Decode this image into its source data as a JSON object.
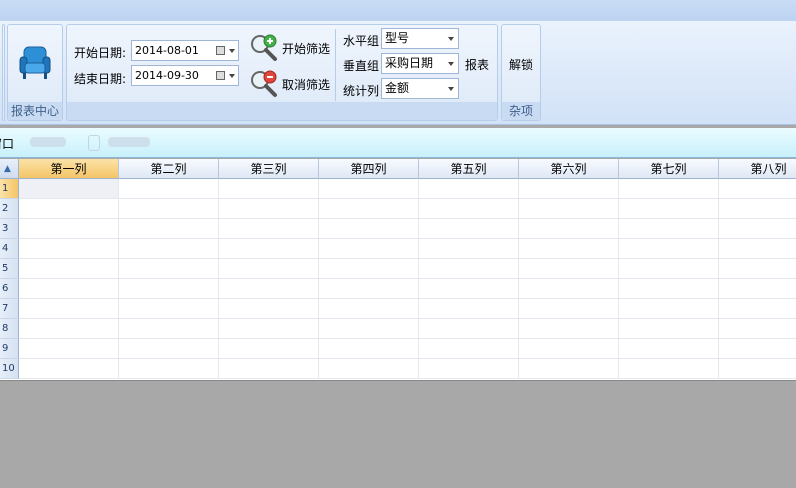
{
  "ribbon": {
    "report_center": {
      "label": "报表中心",
      "icon": "armchair-icon"
    },
    "filter": {
      "start_label": "开始日期:",
      "start_value": "2014-08-01",
      "end_label": "结束日期:",
      "end_value": "2014-09-30",
      "start_filter_label": "开始筛选",
      "cancel_filter_label": "取消筛选",
      "horizontal_label": "水平组",
      "horizontal_value": "型号",
      "vertical_label": "垂直组",
      "vertical_value": "采购日期",
      "stat_label": "统计列",
      "stat_value": "金额",
      "report_label": "报表"
    },
    "misc": {
      "unlock_label": "解锁",
      "group_label": "杂项"
    }
  },
  "tabs": {
    "window_label": "窗口"
  },
  "grid": {
    "columns": [
      "第一列",
      "第二列",
      "第三列",
      "第四列",
      "第五列",
      "第六列",
      "第七列",
      "第八列"
    ],
    "rows": [
      "1",
      "2",
      "3",
      "4",
      "5",
      "6",
      "7",
      "8",
      "9",
      "10"
    ]
  },
  "colors": {
    "accent": "#f4c566",
    "ribbon": "#dbe8f9",
    "workspace": "#a8a8a8"
  }
}
